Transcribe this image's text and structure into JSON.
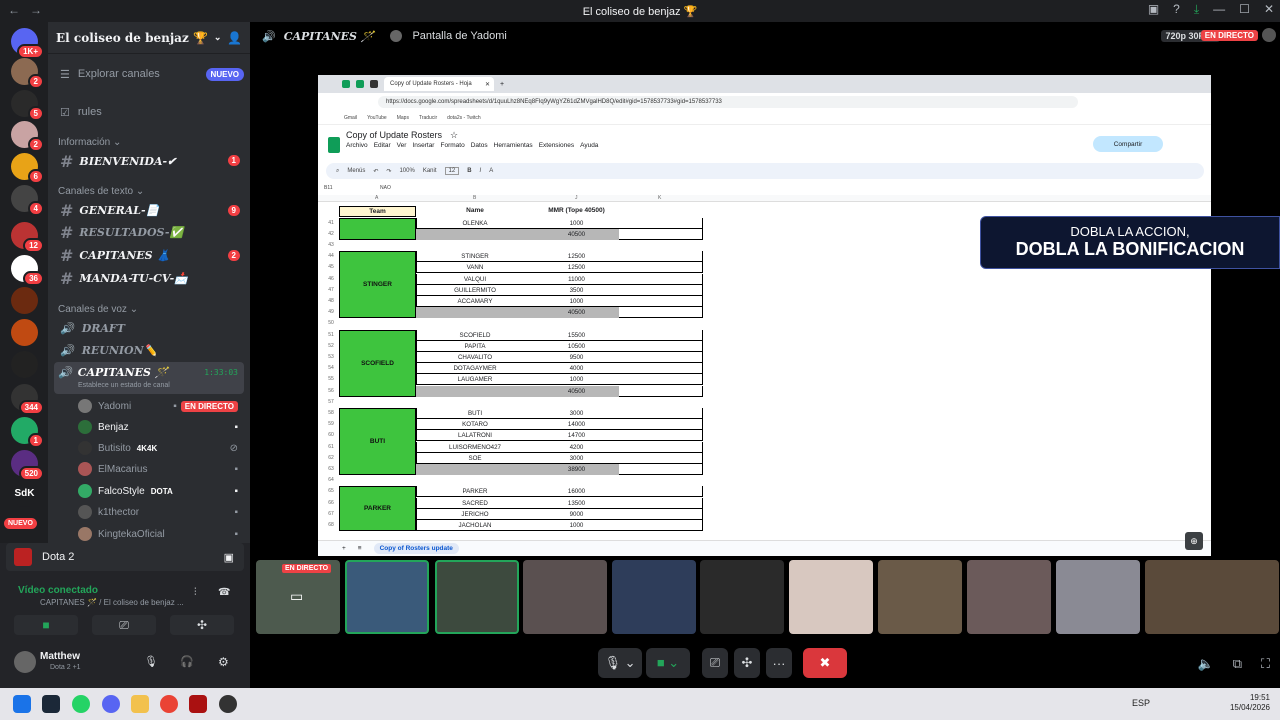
{
  "window": {
    "title": "El coliseo de benjaz 🏆"
  },
  "server_badges": [
    "1K+",
    "2",
    "5",
    "2",
    "6",
    "4",
    "12",
    "36",
    "344",
    "1",
    "520"
  ],
  "new_label": "NUEVO",
  "guild": {
    "name": "El coliseo de benjaz 🏆",
    "explore": "Explorar canales",
    "explore_badge": "NUEVO",
    "rules": "rules"
  },
  "categories": {
    "info": "Información",
    "text": "Canales de texto",
    "voice": "Canales de voz"
  },
  "text_channels": [
    {
      "name": "BIENVENIDA-✔",
      "badge": "1"
    },
    {
      "name": "GENERAL-📄",
      "badge": "9"
    },
    {
      "name": "RESULTADOS-✅",
      "badge": ""
    },
    {
      "name": "CAPITANES 👗",
      "badge": "2"
    },
    {
      "name": "MANDA-TU-CV-📩",
      "badge": ""
    }
  ],
  "voice_channels": [
    {
      "name": "DRAFT"
    },
    {
      "name": "REUNION✏️"
    }
  ],
  "active_voice": {
    "name": "CAPITANES 🪄",
    "timer": "1:33:03",
    "status": "Establece un estado de canal"
  },
  "voice_users": [
    {
      "name": "Yadomi",
      "tag": "EN DIRECTO"
    },
    {
      "name": "Benjaz",
      "tag": ""
    },
    {
      "name": "Butisito",
      "tag": "4K4K"
    },
    {
      "name": "ElMacarius",
      "tag": ""
    },
    {
      "name": "FalcoStyle",
      "tag": "DOTA"
    },
    {
      "name": "k1thector",
      "tag": ""
    },
    {
      "name": "KingtekaOficial",
      "tag": ""
    }
  ],
  "activity": {
    "game": "Dota 2"
  },
  "connection": {
    "status": "Vídeo conectado",
    "where": "CAPITANES 🪄 / El coliseo de benjaz ..."
  },
  "user": {
    "name": "Matthew",
    "status": "Dota 2 +1"
  },
  "stage": {
    "channel": "CAPITANES 🪄",
    "stream": "Pantalla de Yadomi",
    "quality": "720p 30FPS",
    "live": "EN DIRECTO"
  },
  "browser": {
    "tab": "Copy of Update Rosters - Hoja",
    "url": "https://docs.google.com/spreadsheets/d/1quuLhz8NEq8FIq9yWgYZ61dZMVgalHD8Q/edit#gid=1578537733#gid=1578537733",
    "bookmarks": [
      "Gmail",
      "YouTube",
      "Maps",
      "Traducir",
      "dota2s - Twitch"
    ]
  },
  "sheet": {
    "title": "Copy of Update Rosters",
    "menu": [
      "Archivo",
      "Editar",
      "Ver",
      "Insertar",
      "Formato",
      "Datos",
      "Herramientas",
      "Extensiones",
      "Ayuda"
    ],
    "share": "Compartir",
    "toolbar": {
      "menus": "Menús",
      "zoom": "100%",
      "font": "Kanit",
      "size": "12"
    },
    "cell_ref": "B11",
    "formula": "NAO",
    "col_letters": [
      "A",
      "B",
      "J",
      "K"
    ],
    "headers": {
      "team": "Team",
      "name": "Name",
      "mmr": "MMR (Tope 40500)"
    },
    "rows": [
      {
        "n": "41",
        "name": "OLENKA",
        "mmr": "1000"
      },
      {
        "n": "42",
        "name": "",
        "mmr": "40500",
        "total": true
      },
      {
        "n": "43",
        "name": "",
        "mmr": ""
      },
      {
        "n": "44",
        "name": "STINGER",
        "mmr": "12500"
      },
      {
        "n": "45",
        "name": "VANN",
        "mmr": "12500"
      },
      {
        "n": "46",
        "name": "VALQUI",
        "mmr": "11000"
      },
      {
        "n": "47",
        "name": "GUILLERMITO",
        "mmr": "3500"
      },
      {
        "n": "48",
        "name": "ACCAMARY",
        "mmr": "1000"
      },
      {
        "n": "49",
        "name": "",
        "mmr": "40500",
        "total": true
      },
      {
        "n": "50",
        "name": "",
        "mmr": ""
      },
      {
        "n": "51",
        "name": "SCOFIELD",
        "mmr": "15500"
      },
      {
        "n": "52",
        "name": "PAPITA",
        "mmr": "10500"
      },
      {
        "n": "53",
        "name": "CHAVALITO",
        "mmr": "9500"
      },
      {
        "n": "54",
        "name": "DOTAGAYMER",
        "mmr": "4000"
      },
      {
        "n": "55",
        "name": "LAUGAMER",
        "mmr": "1000"
      },
      {
        "n": "56",
        "name": "",
        "mmr": "40500",
        "total": true
      },
      {
        "n": "57",
        "name": "",
        "mmr": ""
      },
      {
        "n": "58",
        "name": "BUTI",
        "mmr": "3000"
      },
      {
        "n": "59",
        "name": "KOTARO",
        "mmr": "14000"
      },
      {
        "n": "60",
        "name": "LALATRONI",
        "mmr": "14700"
      },
      {
        "n": "61",
        "name": "LUISORMENO427",
        "mmr": "4200"
      },
      {
        "n": "62",
        "name": "SOE",
        "mmr": "3000"
      },
      {
        "n": "63",
        "name": "",
        "mmr": "38900",
        "total": true
      },
      {
        "n": "64",
        "name": "",
        "mmr": ""
      },
      {
        "n": "65",
        "name": "PARKER",
        "mmr": "16000"
      },
      {
        "n": "66",
        "name": "SACRED",
        "mmr": "13500"
      },
      {
        "n": "67",
        "name": "JERICHO",
        "mmr": "9000"
      },
      {
        "n": "68",
        "name": "JACHOLAN",
        "mmr": "1000"
      }
    ],
    "teams": [
      "STINGER",
      "SCOFIELD",
      "BUTI",
      "PARKER"
    ],
    "sheet_tab": "Copy of Rosters update"
  },
  "banner": {
    "line1": "DOBLA LA ACCION,",
    "line2": "DOBLA LA BONIFICACION"
  },
  "tiles": {
    "live": "EN DIRECTO"
  },
  "taskbar": {
    "lang": "ESP",
    "time": "19:51",
    "date": "15/04/2026"
  },
  "colors": {
    "green": "#3ec43e",
    "live": "#ed4245",
    "blurple": "#5865f2",
    "total": "#b7b7b7"
  }
}
